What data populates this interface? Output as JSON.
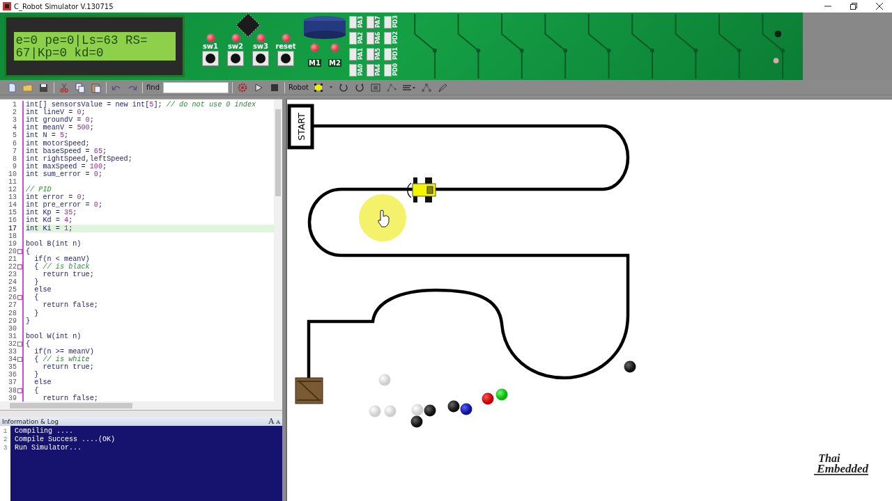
{
  "window": {
    "title": "C_Robot Simulator V.130715"
  },
  "board": {
    "lcd_lines": [
      "e=0 pe=0|Ls=63 RS=",
      "67|Kp=0 kd=0"
    ],
    "switches": [
      {
        "label": "sw1"
      },
      {
        "label": "sw2"
      },
      {
        "label": "sw3"
      },
      {
        "label": "reset"
      }
    ],
    "motors": [
      {
        "label": "M1"
      },
      {
        "label": "M2"
      }
    ],
    "ports": [
      [
        "PA3",
        "PA7",
        "PD3"
      ],
      [
        "PA2",
        "PA6",
        "PD2"
      ],
      [
        "PA1",
        "PA5",
        "PD1"
      ],
      [
        "PA0",
        "PA4",
        "PD0"
      ]
    ]
  },
  "toolbar": {
    "find_label": "find",
    "robot_label": "Robot"
  },
  "editor": {
    "lines": [
      {
        "number": "1",
        "fold": false,
        "current": false,
        "segments": [
          {
            "kind": "code",
            "text": "int[] sensorsValue = new int["
          },
          {
            "kind": "number",
            "text": "5"
          },
          {
            "kind": "code",
            "text": "]; "
          },
          {
            "kind": "comment",
            "text": "// do not use 0 index"
          }
        ]
      },
      {
        "number": "2",
        "fold": false,
        "current": false,
        "segments": [
          {
            "kind": "code",
            "text": "int lineV = "
          },
          {
            "kind": "number",
            "text": "0"
          },
          {
            "kind": "code",
            "text": ";"
          }
        ]
      },
      {
        "number": "3",
        "fold": false,
        "current": false,
        "segments": [
          {
            "kind": "code",
            "text": "int groundV = "
          },
          {
            "kind": "number",
            "text": "0"
          },
          {
            "kind": "code",
            "text": ";"
          }
        ]
      },
      {
        "number": "4",
        "fold": false,
        "current": false,
        "segments": [
          {
            "kind": "code",
            "text": "int meanV = "
          },
          {
            "kind": "number",
            "text": "500"
          },
          {
            "kind": "code",
            "text": ";"
          }
        ]
      },
      {
        "number": "5",
        "fold": false,
        "current": false,
        "segments": [
          {
            "kind": "code",
            "text": "int N = "
          },
          {
            "kind": "number",
            "text": "5"
          },
          {
            "kind": "code",
            "text": ";"
          }
        ]
      },
      {
        "number": "6",
        "fold": false,
        "current": false,
        "segments": [
          {
            "kind": "code",
            "text": "int motorSpeed;"
          }
        ]
      },
      {
        "number": "7",
        "fold": false,
        "current": false,
        "segments": [
          {
            "kind": "code",
            "text": "int baseSpeed = "
          },
          {
            "kind": "number",
            "text": "65"
          },
          {
            "kind": "code",
            "text": ";"
          }
        ]
      },
      {
        "number": "8",
        "fold": false,
        "current": false,
        "segments": [
          {
            "kind": "code",
            "text": "int rightSpeed,leftSpeed;"
          }
        ]
      },
      {
        "number": "9",
        "fold": false,
        "current": false,
        "segments": [
          {
            "kind": "code",
            "text": "int maxSpeed = "
          },
          {
            "kind": "number",
            "text": "100"
          },
          {
            "kind": "code",
            "text": ";"
          }
        ]
      },
      {
        "number": "10",
        "fold": false,
        "current": false,
        "segments": [
          {
            "kind": "code",
            "text": "int sum_error = "
          },
          {
            "kind": "number",
            "text": "0"
          },
          {
            "kind": "code",
            "text": ";"
          }
        ]
      },
      {
        "number": "11",
        "fold": false,
        "current": false
      },
      {
        "number": "12",
        "fold": false,
        "current": false,
        "segments": [
          {
            "kind": "comment",
            "text": "// PID"
          }
        ]
      },
      {
        "number": "13",
        "fold": false,
        "current": false,
        "segments": [
          {
            "kind": "code",
            "text": "int error = "
          },
          {
            "kind": "number",
            "text": "0"
          },
          {
            "kind": "code",
            "text": ";"
          }
        ]
      },
      {
        "number": "14",
        "fold": false,
        "current": false,
        "segments": [
          {
            "kind": "code",
            "text": "int pre_error = "
          },
          {
            "kind": "number",
            "text": "0"
          },
          {
            "kind": "code",
            "text": ";"
          }
        ]
      },
      {
        "number": "15",
        "fold": false,
        "current": false,
        "segments": [
          {
            "kind": "code",
            "text": "int Kp = "
          },
          {
            "kind": "number",
            "text": "35"
          },
          {
            "kind": "code",
            "text": ";"
          }
        ]
      },
      {
        "number": "16",
        "fold": false,
        "current": false,
        "segments": [
          {
            "kind": "code",
            "text": "int Kd = "
          },
          {
            "kind": "number",
            "text": "4"
          },
          {
            "kind": "code",
            "text": ";"
          }
        ]
      },
      {
        "number": "17",
        "fold": false,
        "current": true,
        "segments": [
          {
            "kind": "code",
            "text": "int Ki = "
          },
          {
            "kind": "number",
            "text": "1"
          },
          {
            "kind": "code",
            "text": ";"
          }
        ]
      },
      {
        "number": "18",
        "fold": false,
        "current": false
      },
      {
        "number": "19",
        "fold": false,
        "current": false,
        "segments": [
          {
            "kind": "code",
            "text": "bool B(int n)"
          }
        ]
      },
      {
        "number": "20",
        "fold": true,
        "current": false,
        "segments": [
          {
            "kind": "code",
            "text": "{"
          }
        ]
      },
      {
        "number": "21",
        "fold": false,
        "current": false,
        "segments": [
          {
            "kind": "code",
            "text": "  if(n < meanV)"
          }
        ]
      },
      {
        "number": "22",
        "fold": true,
        "current": false,
        "segments": [
          {
            "kind": "code",
            "text": "  { "
          },
          {
            "kind": "comment",
            "text": "// is black"
          }
        ]
      },
      {
        "number": "23",
        "fold": false,
        "current": false,
        "segments": [
          {
            "kind": "code",
            "text": "    return true;"
          }
        ]
      },
      {
        "number": "24",
        "fold": false,
        "current": false,
        "segments": [
          {
            "kind": "code",
            "text": "  }"
          }
        ]
      },
      {
        "number": "25",
        "fold": false,
        "current": false,
        "segments": [
          {
            "kind": "code",
            "text": "  else"
          }
        ]
      },
      {
        "number": "26",
        "fold": true,
        "current": false,
        "segments": [
          {
            "kind": "code",
            "text": "  {"
          }
        ]
      },
      {
        "number": "27",
        "fold": false,
        "current": false,
        "segments": [
          {
            "kind": "code",
            "text": "    return false;"
          }
        ]
      },
      {
        "number": "28",
        "fold": false,
        "current": false,
        "segments": [
          {
            "kind": "code",
            "text": "  }"
          }
        ]
      },
      {
        "number": "29",
        "fold": false,
        "current": false,
        "segments": [
          {
            "kind": "code",
            "text": "}"
          }
        ]
      },
      {
        "number": "30",
        "fold": false,
        "current": false
      },
      {
        "number": "31",
        "fold": false,
        "current": false,
        "segments": [
          {
            "kind": "code",
            "text": "bool W(int n)"
          }
        ]
      },
      {
        "number": "32",
        "fold": true,
        "current": false,
        "segments": [
          {
            "kind": "code",
            "text": "{"
          }
        ]
      },
      {
        "number": "33",
        "fold": false,
        "current": false,
        "segments": [
          {
            "kind": "code",
            "text": "  if(n >= meanV)"
          }
        ]
      },
      {
        "number": "34",
        "fold": true,
        "current": false,
        "segments": [
          {
            "kind": "code",
            "text": "  { "
          },
          {
            "kind": "comment",
            "text": "// is white"
          }
        ]
      },
      {
        "number": "35",
        "fold": false,
        "current": false,
        "segments": [
          {
            "kind": "code",
            "text": "    return true;"
          }
        ]
      },
      {
        "number": "36",
        "fold": false,
        "current": false,
        "segments": [
          {
            "kind": "code",
            "text": "  }"
          }
        ]
      },
      {
        "number": "37",
        "fold": false,
        "current": false,
        "segments": [
          {
            "kind": "code",
            "text": "  else"
          }
        ]
      },
      {
        "number": "38",
        "fold": true,
        "current": false,
        "segments": [
          {
            "kind": "code",
            "text": "  {"
          }
        ]
      },
      {
        "number": "39",
        "fold": false,
        "current": false,
        "segments": [
          {
            "kind": "code",
            "text": "    return false;"
          }
        ]
      }
    ]
  },
  "log": {
    "title": "Information & Log",
    "font_buttons": [
      "A",
      "A"
    ],
    "lines": [
      {
        "number": "1",
        "text": "Compiling ...."
      },
      {
        "number": "2",
        "text": "Compile Success ....(OK)"
      },
      {
        "number": "3",
        "text": "Run Simulator..."
      }
    ]
  },
  "canvas": {
    "start_label": "START",
    "logo": [
      "Thai",
      "Embedded"
    ]
  }
}
